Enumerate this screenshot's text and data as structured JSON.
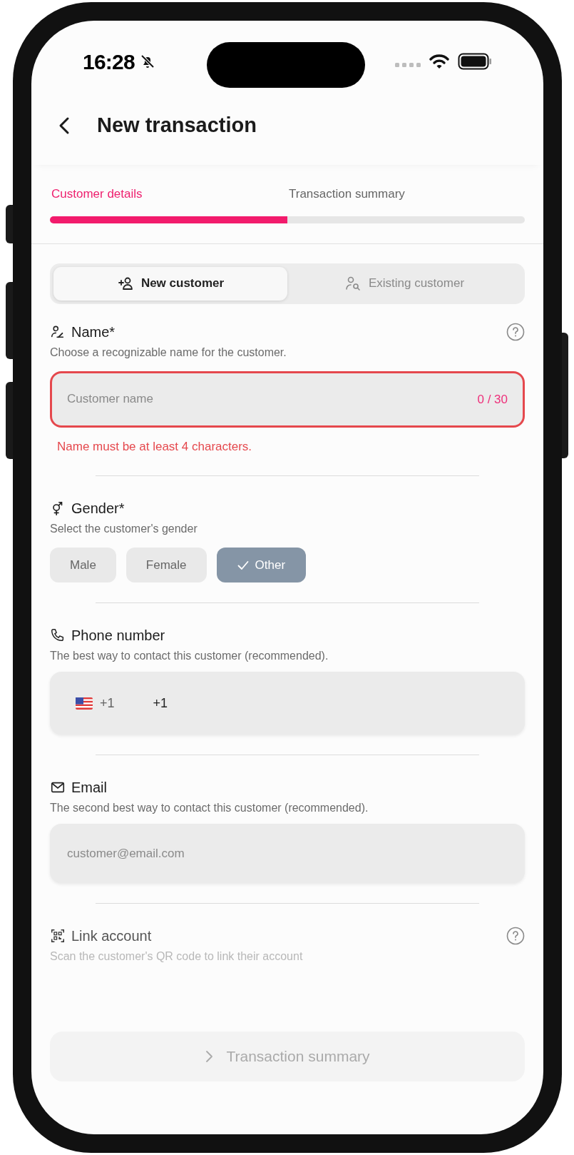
{
  "status_bar": {
    "time": "16:28",
    "silent": true
  },
  "header": {
    "title": "New transaction"
  },
  "steps": [
    {
      "label": "Customer details",
      "selected": true
    },
    {
      "label": "Transaction summary",
      "selected": false
    }
  ],
  "customer_mode": [
    {
      "label": "New customer",
      "selected": true
    },
    {
      "label": "Existing customer",
      "selected": false
    }
  ],
  "sections": [
    {
      "kind": "text_input",
      "title": "Name*",
      "description": "Choose a recognizable name for the customer.",
      "help": true,
      "placeholder": "Customer name",
      "counter": "0 / 30",
      "error": "Name must be at least 4 characters."
    },
    {
      "kind": "choice",
      "title": "Gender*",
      "description": "Select the customer's gender",
      "options": [
        {
          "label": "Male",
          "selected": false
        },
        {
          "label": "Female",
          "selected": false
        },
        {
          "label": "Other",
          "selected": true
        }
      ]
    },
    {
      "kind": "phone",
      "title": "Phone number",
      "description": "The best way to contact this customer (recommended).",
      "country_code": "+1",
      "value": "+1"
    },
    {
      "kind": "text_input",
      "title": "Email",
      "description": "The second best way to contact this customer (recommended).",
      "placeholder": "customer@email.com"
    },
    {
      "kind": "link",
      "title": "Link account",
      "description": "Scan the customer's QR code to link their account",
      "help": true
    }
  ],
  "next_button": {
    "label": "Transaction summary",
    "disabled": true
  }
}
